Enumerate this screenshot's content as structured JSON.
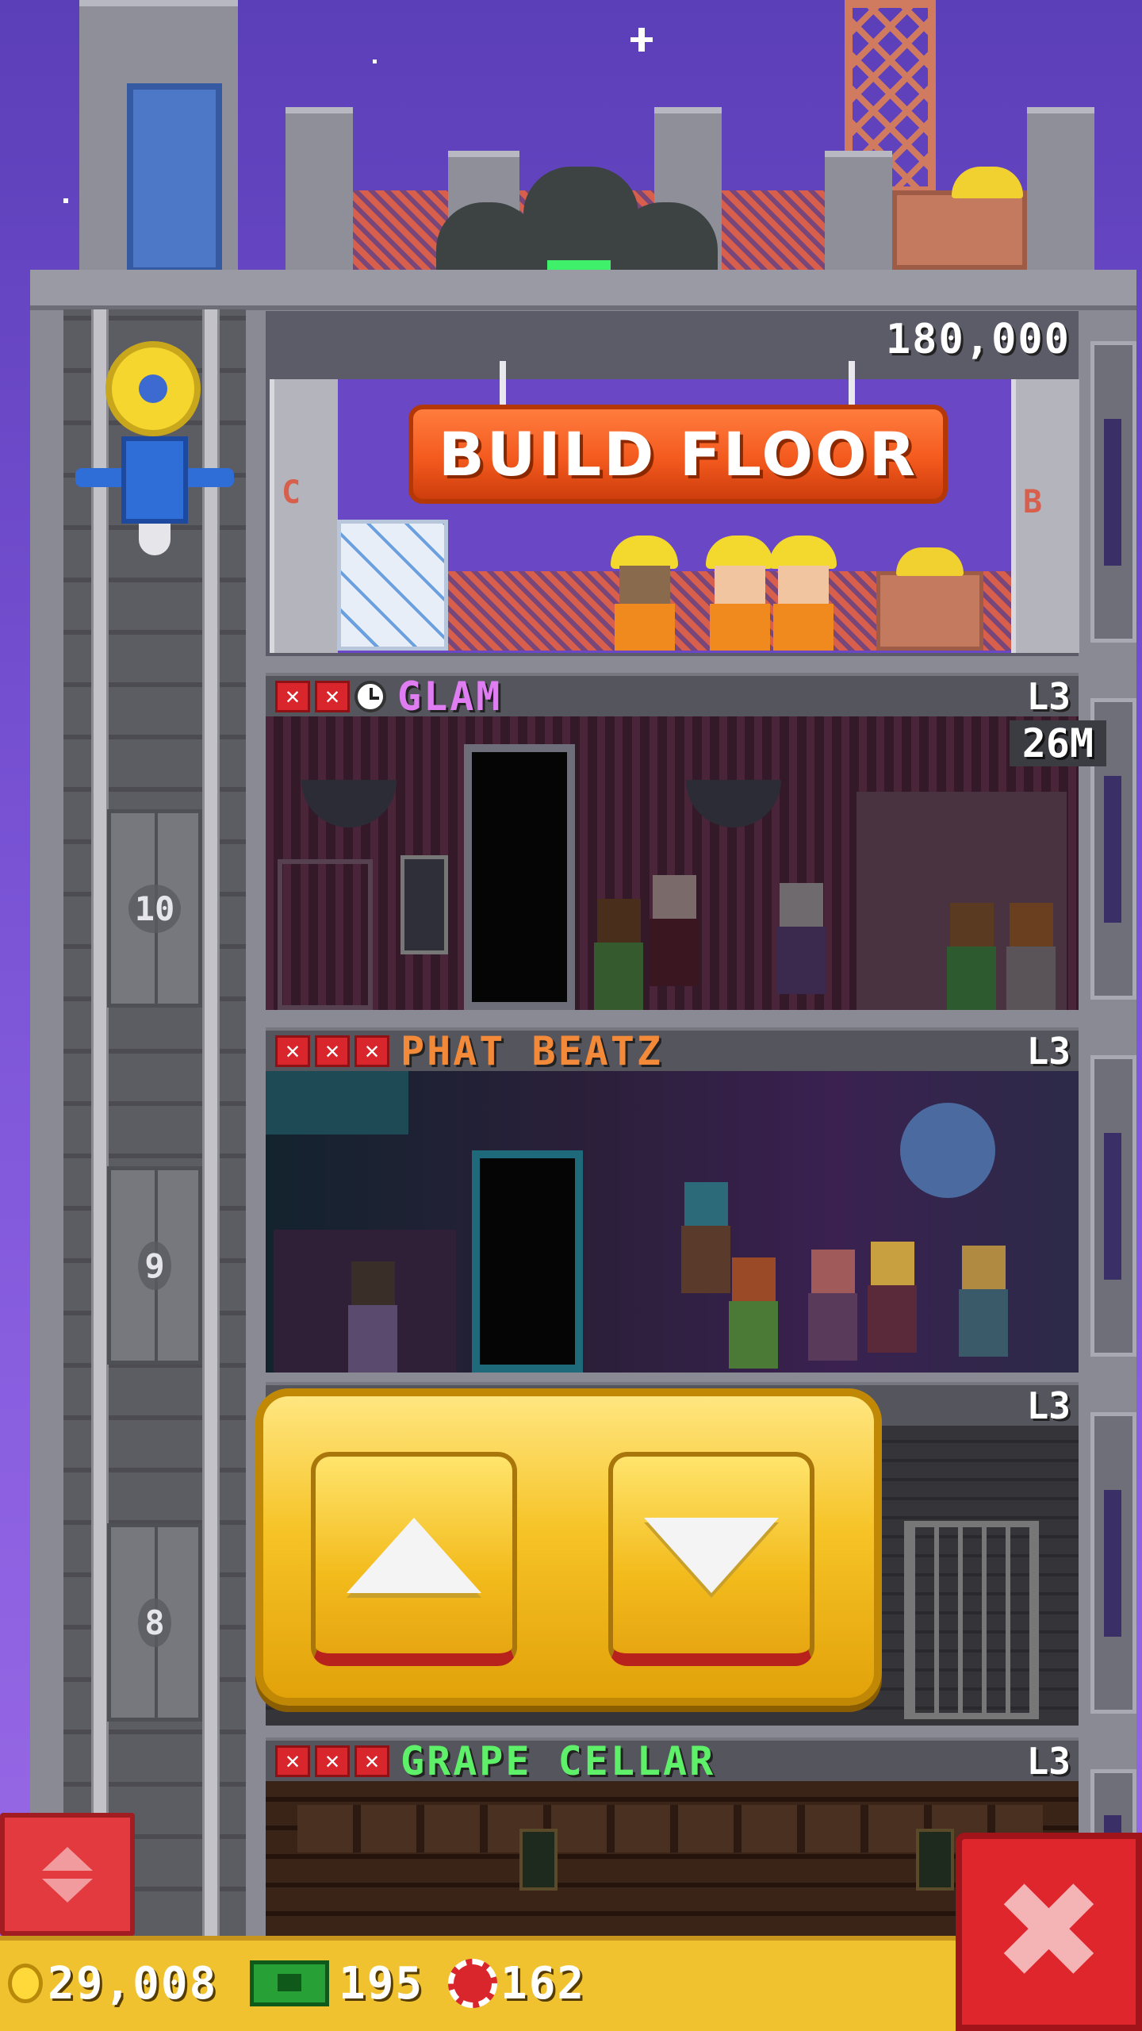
{
  "build_floor": {
    "price": "180,000",
    "button_label": "BUILD FLOOR",
    "left_tag": "C",
    "right_tag": "B"
  },
  "floors": [
    {
      "name": "GLAM",
      "level": "L3",
      "name_color": "#e17df2",
      "marks": [
        "x",
        "x",
        "clock"
      ],
      "earning": "26M"
    },
    {
      "name": "PHAT BEATZ",
      "level": "L3",
      "name_color": "#f28a3a",
      "marks": [
        "x",
        "x",
        "x"
      ]
    },
    {
      "name": "",
      "level": "L3",
      "marks": []
    },
    {
      "name": "GRAPE CELLAR",
      "level": "L3",
      "name_color": "#5ff06a",
      "marks": [
        "x",
        "x",
        "x"
      ]
    }
  ],
  "elevator_floors": [
    "10",
    "9",
    "8"
  ],
  "currency": {
    "coins": "29,008",
    "bux": "195",
    "chips": "162"
  },
  "icons": {
    "coin": "coin-icon",
    "bux": "bux-icon",
    "chip": "chip-icon",
    "close": "close-icon",
    "up": "arrow-up-icon",
    "down": "arrow-down-icon"
  },
  "colors": {
    "sky": "#6a48c6",
    "build_button": "#f45a1e",
    "control_gold": "#f6c326",
    "close_red": "#e0262d",
    "bottom_bar": "#f1c230"
  }
}
